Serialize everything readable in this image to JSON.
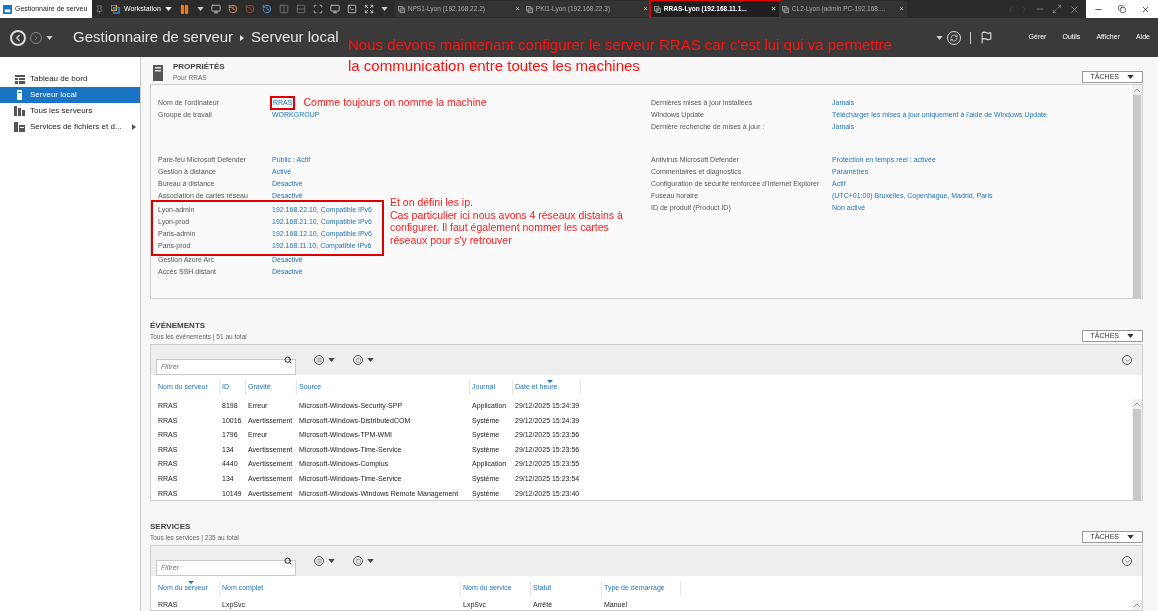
{
  "vm": {
    "window_title": "Gestionnaire de serveu",
    "product": "Workstation",
    "tabs": [
      {
        "label": "NPS1-Lyon (192.168.22.2)",
        "close": "×",
        "selected": false,
        "highlighted": false
      },
      {
        "label": "PKI1-Lyon (192.168.22.3)",
        "close": "×",
        "selected": false,
        "highlighted": false
      },
      {
        "label": "RRAS-Lyon (192.168.11.1...",
        "close": "×",
        "selected": true,
        "highlighted": true
      },
      {
        "label": "CL2-Lyon (admin PC-192.168....",
        "close": "×",
        "selected": false,
        "highlighted": false
      }
    ]
  },
  "header": {
    "breadcrumb": [
      "Gestionnaire de serveur",
      "Serveur local"
    ],
    "menu": [
      "Gérer",
      "Outils",
      "Afficher",
      "Aide"
    ],
    "note": [
      "Nous devons maintenant configurer le serveur RRAS car c'est lui qui va permettre",
      "la communication entre toutes les machines"
    ]
  },
  "sidebar": {
    "items": [
      {
        "label": "Tableau de bord",
        "kind": "dashboard",
        "selected": false,
        "submenu": false
      },
      {
        "label": "Serveur local",
        "kind": "server",
        "selected": true,
        "submenu": false
      },
      {
        "label": "Tous les serveurs",
        "kind": "servers",
        "selected": false,
        "submenu": false
      },
      {
        "label": "Services de fichiers et d...",
        "kind": "files",
        "selected": false,
        "submenu": true
      }
    ]
  },
  "properties": {
    "title": "PROPRIÉTÉS",
    "subtitle": "Pour RRAS",
    "tasks": "TÂCHES",
    "left": [
      {
        "rows": [
          {
            "kind": "row",
            "label": "Nom de l'ordinateur",
            "value": "RRAS",
            "highlighted": true,
            "note": "Comme toujours on nomme la machine"
          },
          {
            "kind": "row",
            "label": "Groupe de travail",
            "value": "WORKGROUP",
            "highlighted": false
          }
        ]
      },
      {
        "rows": [
          {
            "kind": "row",
            "label": "Pare-feu Microsoft Defender",
            "value": "Public : Actif",
            "highlighted": false
          },
          {
            "kind": "row",
            "label": "Gestion à distance",
            "value": "Activé",
            "highlighted": false
          },
          {
            "kind": "row",
            "label": "Bureau à distance",
            "value": "Désactivé",
            "highlighted": false
          },
          {
            "kind": "row",
            "label": "Association de cartes réseau",
            "value": "Désactivé",
            "highlighted": false
          },
          {
            "kind": "frame",
            "highlighted": true,
            "note": [
              "Et on défini les ip.",
              "Cas particulier ici nous avons 4 réseaux distains à configurer. Il faut également nommer les cartes réseaux pour s'y retrouver"
            ],
            "rows": [
              {
                "label": "Lyon-admin",
                "value": "192.168.22.10, Compatible IPv6"
              },
              {
                "label": "Lyon-prod",
                "value": "192.168.21.10, Compatible IPv6"
              },
              {
                "label": "Paris-admin",
                "value": "192.168.12.10, Compatible IPv6"
              },
              {
                "label": "Paris-prod",
                "value": "192.168.11.10, Compatible IPv6"
              }
            ]
          },
          {
            "kind": "row",
            "label": "Gestion Azure Arc",
            "value": "Désactivé",
            "highlighted": false
          },
          {
            "kind": "row",
            "label": "Accès SSH distant",
            "value": "Désactivé",
            "highlighted": false
          }
        ]
      }
    ],
    "right": [
      {
        "rows": [
          {
            "label": "Dernières mises à jour installées",
            "value": "Jamais"
          },
          {
            "label": "Windows Update",
            "value": "Télécharger les mises à jour uniquement à l'aide de Windows Update"
          },
          {
            "label": "Dernière recherche de mises à jour :",
            "value": "Jamais"
          }
        ]
      },
      {
        "rows": [
          {
            "label": "Antivirus Microsoft Defender",
            "value": "Protection en temps réel : activée"
          },
          {
            "label": "Commentaires et diagnostics",
            "value": "Paramètres"
          },
          {
            "label": "Configuration de sécurité renforcée d'Internet Explorer",
            "value": "Actif"
          },
          {
            "label": "Fuseau horaire",
            "value": "(UTC+01:00) Bruxelles, Copenhague, Madrid, Paris"
          },
          {
            "label": "ID de produit (Product ID)",
            "value": "Non activé"
          }
        ]
      }
    ]
  },
  "events": {
    "title": "ÉVÉNEMENTS",
    "subtitle": "Tous les événements | 51 au total",
    "tasks": "TÂCHES",
    "filter_placeholder": "Filtrer",
    "columns": [
      {
        "label": "Nom du serveur",
        "sorted": false
      },
      {
        "label": "ID",
        "sorted": false
      },
      {
        "label": "Gravité",
        "sorted": false
      },
      {
        "label": "Source",
        "sorted": false
      },
      {
        "label": "Journal",
        "sorted": false
      },
      {
        "label": "Date et heure",
        "sorted": true
      }
    ],
    "rows": [
      [
        "RRAS",
        "8198",
        "Erreur",
        "Microsoft-Windows-Security-SPP",
        "Application",
        "29/12/2025 15:24:39"
      ],
      [
        "RRAS",
        "10016",
        "Avertissement",
        "Microsoft-Windows-DistributedCOM",
        "Système",
        "29/12/2025 15:24:39"
      ],
      [
        "RRAS",
        "1796",
        "Erreur",
        "Microsoft-Windows-TPM-WMI",
        "Système",
        "29/12/2025 15:23:56"
      ],
      [
        "RRAS",
        "134",
        "Avertissement",
        "Microsoft-Windows-Time-Service",
        "Système",
        "29/12/2025 15:23:56"
      ],
      [
        "RRAS",
        "4440",
        "Avertissement",
        "Microsoft-Windows-Complus",
        "Application",
        "29/12/2025 15:23:55"
      ],
      [
        "RRAS",
        "134",
        "Avertissement",
        "Microsoft-Windows-Time-Service",
        "Système",
        "29/12/2025 15:23:54"
      ],
      [
        "RRAS",
        "10149",
        "Avertissement",
        "Microsoft-Windows-Windows Remote Management",
        "Système",
        "29/12/2025 15:23:40"
      ]
    ]
  },
  "services": {
    "title": "SERVICES",
    "subtitle": "Tous les services | 235 au total",
    "tasks": "TÂCHES",
    "filter_placeholder": "Filtrer",
    "columns": [
      {
        "label": "Nom du serveur",
        "sorted": true
      },
      {
        "label": "Nom complet",
        "sorted": false
      },
      {
        "label": "Nom du service",
        "sorted": false
      },
      {
        "label": "Statut",
        "sorted": false
      },
      {
        "label": "Type de démarrage",
        "sorted": false
      }
    ],
    "rows": [
      [
        "RRAS",
        "LxpSvc",
        "LxpSvc",
        "Arrêté",
        "Manuel"
      ]
    ]
  }
}
